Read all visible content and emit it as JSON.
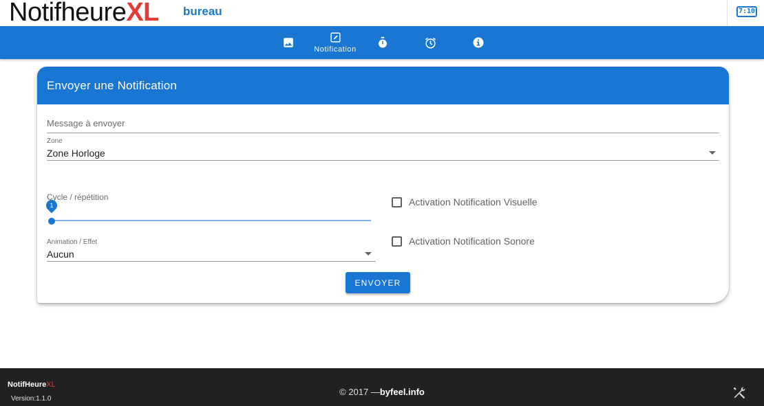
{
  "header": {
    "brand_main": "Notifheure",
    "brand_accent": "XL",
    "subtitle": "bureau",
    "clock_badge": "7:10",
    "clock_icon": "digital-clock-icon"
  },
  "nav": {
    "items": [
      {
        "icon": "image-icon",
        "label": ""
      },
      {
        "icon": "edit-icon",
        "label": "Notification"
      },
      {
        "icon": "stopwatch-icon",
        "label": ""
      },
      {
        "icon": "alarm-icon",
        "label": ""
      },
      {
        "icon": "info-icon",
        "label": ""
      }
    ],
    "active_index": 1
  },
  "card": {
    "title": "Envoyer une Notification",
    "message": {
      "placeholder": "Message à envoyer",
      "value": ""
    },
    "zone": {
      "label": "Zone",
      "value": "Zone Horloge"
    },
    "cycle": {
      "label": "Cycle / répétition",
      "value": 1
    },
    "animation": {
      "label": "Animation / Effet",
      "value": "Aucun"
    },
    "visual_checkbox": {
      "label": "Activation Notification Visuelle",
      "checked": false
    },
    "sound_checkbox": {
      "label": "Activation Notification Sonore",
      "checked": false
    },
    "send_button": "ENVOYER"
  },
  "footer": {
    "brand_main": "NotifHeure",
    "brand_accent": "XL",
    "version": "Version:1.1.0",
    "copyright_prefix": "© 2017 —",
    "copyright_site": "byfeel.info",
    "tools_icon": "tools-icon"
  },
  "colors": {
    "primary": "#1976d2",
    "accent": "#e53935",
    "footer_bg": "#212121"
  }
}
